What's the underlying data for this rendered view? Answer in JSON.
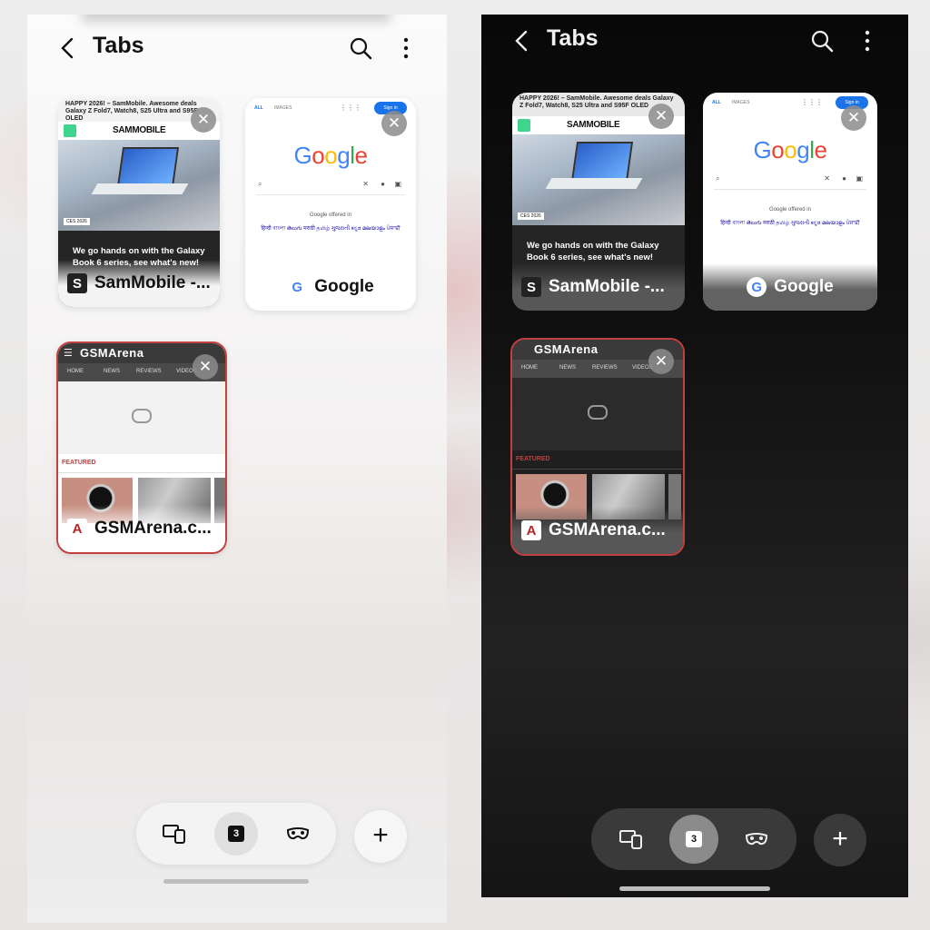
{
  "header": {
    "title": "Tabs"
  },
  "tabs": [
    {
      "title": "SamMobile -...",
      "favicon": "S",
      "page": {
        "banner": "HAPPY 2026! – SamMobile. Awesome deals Galaxy Z Fold7, Watch8, S25 Ultra and S95F OLED",
        "logo": "SAMMOBILE",
        "tag": "CES 2026",
        "headline": "We go hands on with the Galaxy Book 6 series, see what's new!"
      }
    },
    {
      "title": "Google",
      "favicon": "G",
      "page": {
        "tab_all": "ALL",
        "tab_images": "IMAGES",
        "sign_in": "Sign in",
        "logo": "Google",
        "offered_in": "Google offered in",
        "languages": "हिन्दी  বাংলা  తెలుగు  मराठी  தமிழ்  ગુજરાતી  ಕನ್ನಡ  മലയാളം  ਪੰਜਾਬੀ"
      }
    },
    {
      "title": "GSMArena.c...",
      "favicon": "A",
      "page": {
        "logo": "GSMArena",
        "nav": [
          "HOME",
          "NEWS",
          "REVIEWS",
          "VIDEOS"
        ],
        "featured": "FEATURED"
      }
    }
  ],
  "bottom_bar": {
    "tab_count": "3"
  },
  "icons": {
    "back": "back-arrow-icon",
    "search": "search-icon",
    "more": "more-vertical-icon",
    "close": "close-icon",
    "devices": "devices-icon",
    "secret": "secret-mode-mask-icon",
    "add": "plus-icon"
  }
}
